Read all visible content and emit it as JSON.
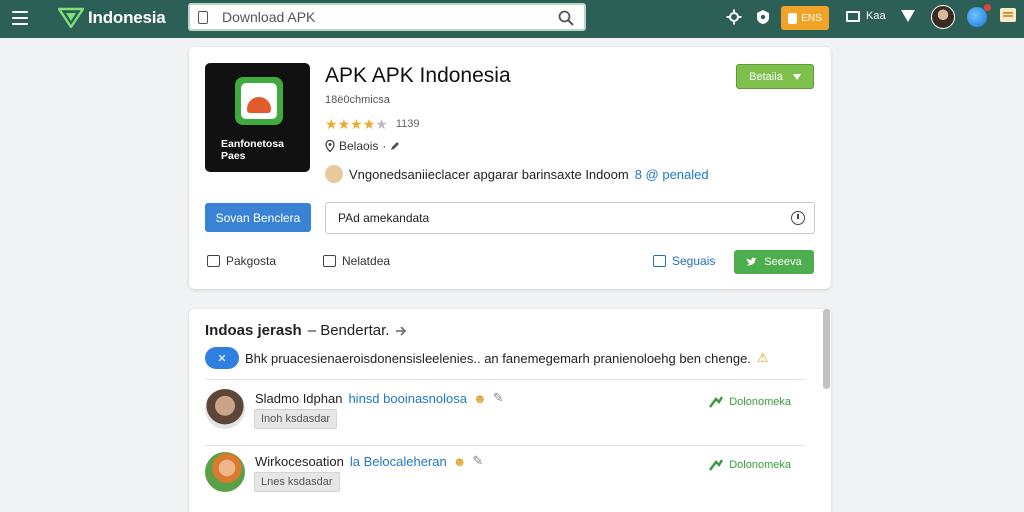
{
  "topbar": {
    "brand": "Indonesia",
    "search_placeholder": "Download APK",
    "button_label": "ENS",
    "lang_label": "Kaa"
  },
  "app": {
    "icon_label": "Eanfonetosa Paes",
    "title": "APK APK Indonesia",
    "subtitle": "18ë0chmicsa",
    "rating_count": "1139",
    "rating": 3.5,
    "location": "Belaois",
    "developer_text": "Vngonedsaniieclacer apgarar barinsaxte Indoom",
    "developer_link": "8 @ penaled",
    "top_button": "Betaila",
    "download_button": "Sovan Benclera",
    "package_value": "PAd amekandata",
    "action_1": "Pakgosta",
    "action_2": "Nelatdea",
    "share_link": "Seguais",
    "share_button": "Seeeva"
  },
  "comments": {
    "title_bold": "Indoas jerash",
    "title_rest": "– Bendertar.",
    "notice_pill": "✕",
    "notice_text": "Bhk pruacesienaeroisdonensisleelenies.. an fanemegemarh pranienoloehg ben chenge.",
    "items": [
      {
        "name": "Sladmo Idphan",
        "link": "hinsd booinasnolosa",
        "tag": "Inoh ksdasdar",
        "reply": "Dolonomeka"
      },
      {
        "name": "Wirkocesoation",
        "link": "la Belocaleheran",
        "tag": "Lnes ksdasdar",
        "reply": "Dolonomeka"
      }
    ]
  },
  "colors": {
    "topbar": "#2c5f55",
    "green": "#7ec04c",
    "blue": "#3a83d4",
    "orange": "#f0a326"
  }
}
